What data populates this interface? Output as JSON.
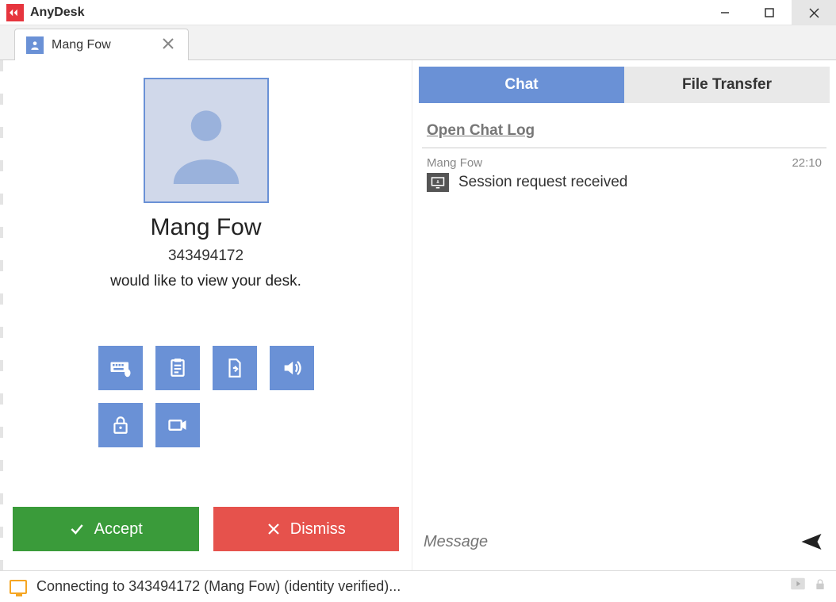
{
  "app": {
    "title": "AnyDesk"
  },
  "tab": {
    "title": "Mang Fow"
  },
  "request": {
    "name": "Mang Fow",
    "id": "343494172",
    "text": "would like to view your desk."
  },
  "actions": {
    "accept": "Accept",
    "dismiss": "Dismiss"
  },
  "right_tabs": {
    "chat": "Chat",
    "file_transfer": "File Transfer"
  },
  "chat": {
    "open_log": "Open Chat Log",
    "items": [
      {
        "from": "Mang Fow",
        "time": "22:10",
        "message": "Session request received"
      }
    ],
    "input_placeholder": "Message"
  },
  "status": {
    "text": "Connecting to 343494172 (Mang Fow) (identity verified)..."
  }
}
